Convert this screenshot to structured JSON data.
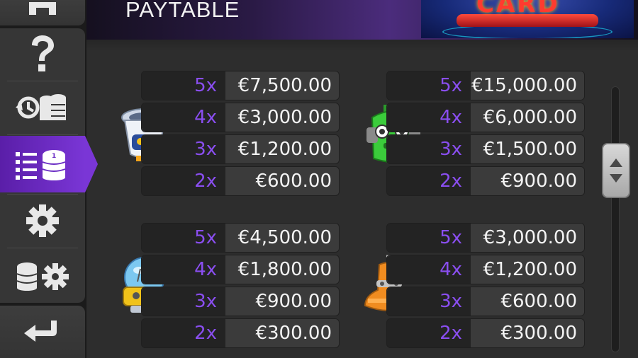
{
  "header": {
    "title": "PAYTABLE",
    "logo_text": "CARD"
  },
  "sidebar": {
    "items": [
      {
        "name": "home",
        "icon": "home-icon"
      },
      {
        "name": "help",
        "icon": "question-mark-icon"
      },
      {
        "name": "history",
        "icon": "history-coins-icon"
      },
      {
        "name": "paytable",
        "icon": "paytable-list-coins-icon",
        "active": true
      },
      {
        "name": "settings",
        "icon": "gear-icon"
      },
      {
        "name": "bet-settings",
        "icon": "coins-gear-icon"
      },
      {
        "name": "back",
        "icon": "back-arrow-icon"
      }
    ],
    "active_color": "#7a36d6"
  },
  "paytable": {
    "multiplier_color": "#8a4ef0",
    "symbols": [
      {
        "icon": "white-robot-head-icon",
        "rows": [
          {
            "mult": "5x",
            "prize": "€7,500.00"
          },
          {
            "mult": "4x",
            "prize": "€3,000.00"
          },
          {
            "mult": "3x",
            "prize": "€1,200.00"
          },
          {
            "mult": "2x",
            "prize": "€600.00"
          }
        ]
      },
      {
        "icon": "green-robot-head-icon",
        "rows": [
          {
            "mult": "5x",
            "prize": "€15,000.00"
          },
          {
            "mult": "4x",
            "prize": "€6,000.00"
          },
          {
            "mult": "3x",
            "prize": "€1,500.00"
          },
          {
            "mult": "2x",
            "prize": "€900.00"
          }
        ]
      },
      {
        "icon": "yellow-dome-robot-head-icon",
        "rows": [
          {
            "mult": "5x",
            "prize": "€4,500.00"
          },
          {
            "mult": "4x",
            "prize": "€1,800.00"
          },
          {
            "mult": "3x",
            "prize": "€900.00"
          },
          {
            "mult": "2x",
            "prize": "€300.00"
          }
        ]
      },
      {
        "icon": "orange-bell-robot-head-icon",
        "rows": [
          {
            "mult": "5x",
            "prize": "€3,000.00"
          },
          {
            "mult": "4x",
            "prize": "€1,200.00"
          },
          {
            "mult": "3x",
            "prize": "€600.00"
          },
          {
            "mult": "2x",
            "prize": "€300.00"
          }
        ]
      }
    ]
  },
  "scrollbar": {
    "up_icon": "scroll-up-icon",
    "down_icon": "scroll-down-icon"
  }
}
